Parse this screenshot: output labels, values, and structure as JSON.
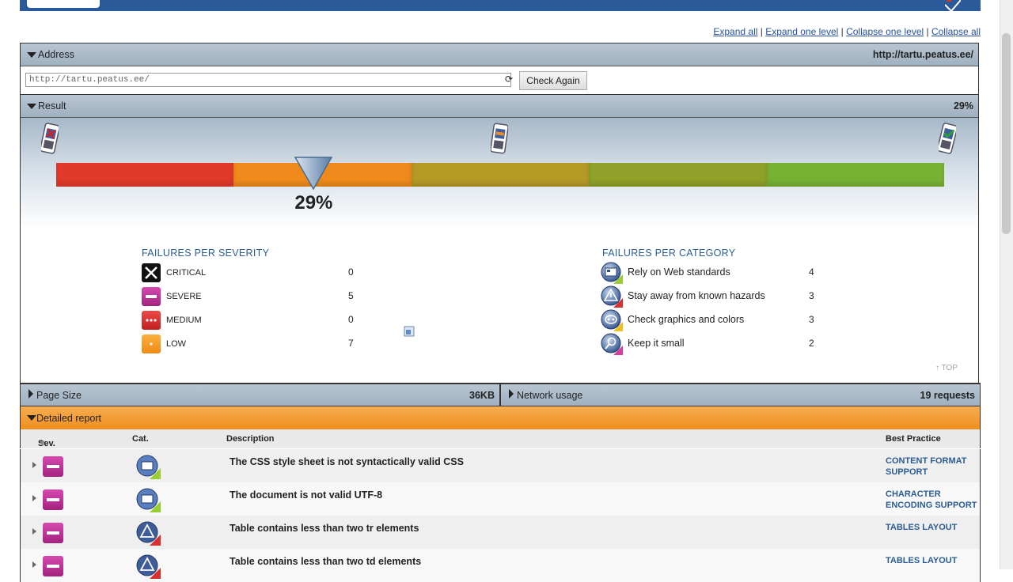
{
  "expand_links": [
    "Expand all",
    "Expand one level",
    "Collapse one level",
    "Collapse all"
  ],
  "address": {
    "section_title": "Address",
    "url_display": "http://tartu.peatus.ee/",
    "input_value": "http://tartu.peatus.ee/",
    "check_button": "Check Again"
  },
  "result": {
    "section_title": "Result",
    "score": "29%",
    "score_big": "29%",
    "score_value": 0.29,
    "bar_colors": [
      "#e13a2a",
      "#f08a1c",
      "#b59a26",
      "#8fa128",
      "#78b233"
    ],
    "failures_per_severity": {
      "title": "FAILURES PER SEVERITY",
      "items": [
        {
          "label": "CRITICAL",
          "count": "0"
        },
        {
          "label": "SEVERE",
          "count": "5"
        },
        {
          "label": "MEDIUM",
          "count": "0"
        },
        {
          "label": "LOW",
          "count": "7"
        }
      ]
    },
    "failures_per_category": {
      "title": "FAILURES PER CATEGORY",
      "items": [
        {
          "label": "Rely on Web standards",
          "count": "4"
        },
        {
          "label": "Stay away from known hazards",
          "count": "3"
        },
        {
          "label": "Check graphics and colors",
          "count": "3"
        },
        {
          "label": "Keep it small",
          "count": "2"
        }
      ]
    },
    "top_link": "↑ TOP"
  },
  "page_size": {
    "label": "Page Size",
    "value": "36KB"
  },
  "network_usage": {
    "label": "Network usage",
    "value": "19 requests"
  },
  "detailed_report": {
    "section_title": "Detailed report",
    "columns": {
      "sev": "Sev.",
      "cat": "Cat.",
      "description": "Description",
      "best_practice": "Best Practice"
    },
    "rows": [
      {
        "description": "The CSS style sheet is not syntactically valid CSS",
        "best_practice": "CONTENT FORMAT SUPPORT",
        "category": "web-standards"
      },
      {
        "description": "The document is not valid UTF-8",
        "best_practice": "CHARACTER ENCODING SUPPORT",
        "category": "web-standards"
      },
      {
        "description": "Table contains less than two tr elements",
        "best_practice": "TABLES LAYOUT",
        "category": "hazards"
      },
      {
        "description": "Table contains less than two td elements",
        "best_practice": "TABLES LAYOUT",
        "category": "hazards"
      }
    ]
  }
}
